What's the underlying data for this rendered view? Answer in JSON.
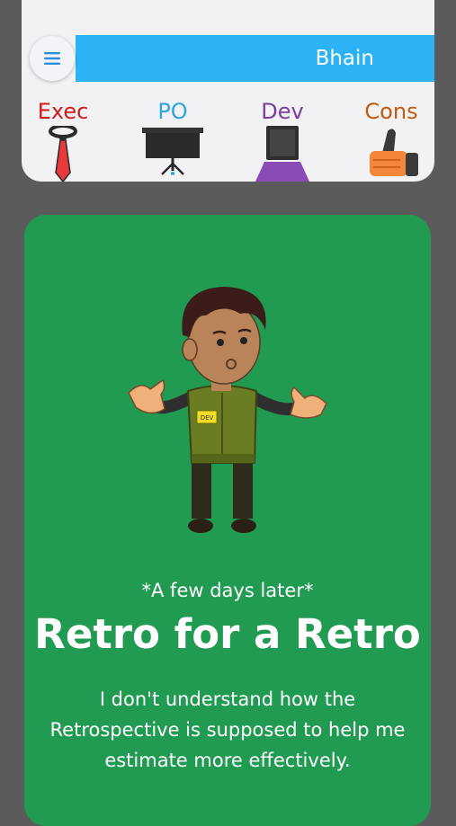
{
  "header": {
    "title": "Bhain",
    "menu_icon": "hamburger-menu-icon",
    "bar_color": "#2bb3f5"
  },
  "roles": [
    {
      "label": "Exec",
      "icon": "tie-icon",
      "color": "#d11a1a"
    },
    {
      "label": "PO",
      "icon": "presentation-board-icon",
      "color": "#2ba6de"
    },
    {
      "label": "Dev",
      "icon": "laptop-icon",
      "color": "#7a3f9c"
    },
    {
      "label": "Cons",
      "icon": "thumbs-up-icon",
      "color": "#c25a0c"
    }
  ],
  "story": {
    "background": "#219a52",
    "subtitle": "*A few days later*",
    "title": "Retro for a Retro",
    "body": "I don't understand how the Retrospective is supposed to help me estimate more effectively.",
    "character_badge": "DEV"
  }
}
